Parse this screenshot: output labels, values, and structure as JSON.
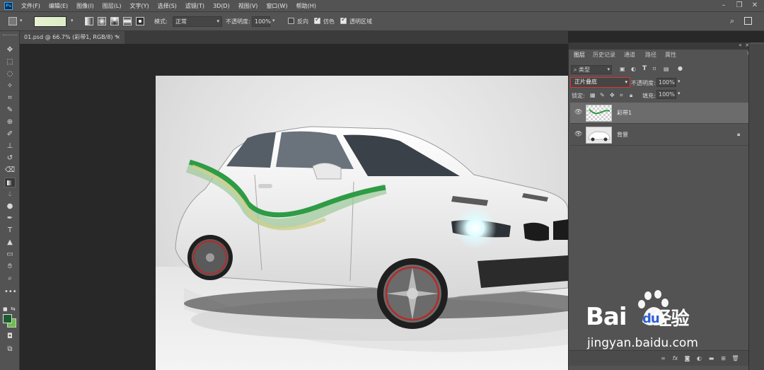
{
  "menubar": {
    "logo": "Ps",
    "items": [
      "文件(F)",
      "编辑(E)",
      "图像(I)",
      "图层(L)",
      "文字(Y)",
      "选择(S)",
      "滤镜(T)",
      "3D(D)",
      "视图(V)",
      "窗口(W)",
      "帮助(H)"
    ],
    "window_controls": [
      "minimize-icon",
      "restore-icon",
      "close-icon"
    ]
  },
  "options": {
    "mode_label": "模式:",
    "mode_value": "正常",
    "opacity_label": "不透明度:",
    "opacity_value": "100%",
    "reverse_label": "反向",
    "reverse_checked": false,
    "dither_label": "仿色",
    "dither_checked": true,
    "transparency_label": "透明区域",
    "transparency_checked": true
  },
  "document": {
    "tab_label": "01.psd @ 66.7% (彩带1, RGB/8) *",
    "close": "×"
  },
  "layers_panel": {
    "tabs": [
      "图层",
      "历史记录",
      "通道",
      "路径",
      "属性"
    ],
    "active_tab": "图层",
    "filter_label": "类型",
    "blend_mode": "正片叠底",
    "opacity_label": "不透明度:",
    "opacity_value": "100%",
    "lock_label": "锁定:",
    "fill_label": "填充:",
    "fill_value": "100%",
    "layers": [
      {
        "name": "彩带1",
        "selected": true,
        "visible": true,
        "locked": false
      },
      {
        "name": "背景",
        "selected": false,
        "visible": true,
        "locked": true
      }
    ]
  },
  "watermark": {
    "brand_a": "Bai",
    "brand_b": "du",
    "brand_cn": "经验",
    "url": "jingyan.baidu.com"
  },
  "colors": {
    "foreground": "#1a5e2e",
    "background": "#6dbd4a",
    "highlight_box": "#e0322f"
  }
}
